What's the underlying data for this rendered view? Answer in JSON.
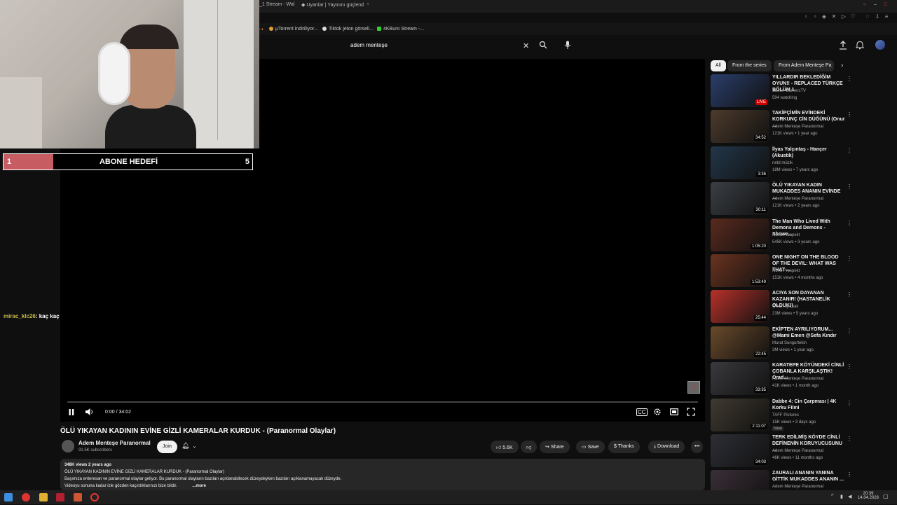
{
  "browser": {
    "tabs": [
      "_1 Stream - Wal",
      "Uyarılar | Yayınını güçlend"
    ],
    "bookmarks": [
      "μTorrent indiriliyor...",
      "Tiktok jeton görseli...",
      "4KBuro Stream -..."
    ]
  },
  "header": {
    "search_value": "adem menteşe"
  },
  "overlay": {
    "goal_label": "ABONE HEDEFİ",
    "goal_current": "1",
    "goal_target": "5",
    "goal_fraction": 0.2,
    "chat_user": "mirac_klc26",
    "chat_message": ": kaç kaç"
  },
  "player": {
    "time": "0:00 / 34:02"
  },
  "video": {
    "title": "ÖLÜ YIKAYAN KADININ EVİNE GİZLİ KAMERALAR KURDUK - (Paranormal Olaylar)",
    "channel": "Adem Menteşe Paranormal",
    "subscribers": "91.5K subscribers",
    "join_label": "Join",
    "likes": "5.6K",
    "share_label": "Share",
    "save_label": "Save",
    "thanks_label": "Thanks",
    "download_label": "Download"
  },
  "description": {
    "meta": "348K views  2 years ago",
    "line1": "ÖLÜ YIKAYAN KADININ EVİNE GİZLİ KAMERALAR KURDUK - (Paranormal Olaylar)",
    "line2": "Başımıza enteresan ve paranormal olaylar geliyor. Bu paranormal olayların bazıları açıklanabilecek düzeydeyken bazıları açıklanamayacak düzeyde.",
    "line3": "Videoyu sonuna kadar izle gözden kaçırdıklarınızı bize bildir.",
    "more": "...more"
  },
  "sidebar": {
    "chips": [
      "All",
      "From the series",
      "From Adem Menteşe Pa"
    ],
    "videos": [
      {
        "title": "YILLARDIR BEKLEDİĞİM OYUN!! - REPLACED TÜRKÇE BÖLÜM 1",
        "channel": "Easter GamersTV",
        "meta": "594 watching",
        "duration": "LIVE",
        "color": "#2a3e6b"
      },
      {
        "title": "TAKİPÇİMİN EVİNDEKİ KORKUNÇ CİN DÜĞÜNÜ (Onur ...",
        "channel": "Adem Menteşe Paranormal",
        "meta": "121K views • 1 year ago",
        "duration": "34:52",
        "color": "#4d3b2c"
      },
      {
        "title": "İlyas Yalçıntaş - Hançer (Akustik)",
        "channel": "netd müzik",
        "meta": "18M views • 7 years ago",
        "duration": "3:36",
        "color": "#22374a"
      },
      {
        "title": "ÖLÜ YIKAYAN KADIN MUKADDES ANANIN EVİNDE ...",
        "channel": "Adem Menteşe Paranormal",
        "meta": "121K views • 2 years ago",
        "duration": "30:11",
        "color": "#3b3f44"
      },
      {
        "title": "The Man Who Lived With Demons and Demons - Showe...",
        "channel": "Nova Prospekt",
        "meta": "545K views • 3 years ago",
        "duration": "1:05:20",
        "color": "#5a2a1e"
      },
      {
        "title": "ONE NIGHT ON THE BLOOD OF THE DEVIL: WHAT WAS THAT ...",
        "channel": "Nova Prospekt",
        "meta": "151K views • 4 months ago",
        "duration": "1:53:49",
        "color": "#6b3320"
      },
      {
        "title": "ACIYA SON DAYANAN KAZANIR! (HASTANELİK OLDUK!)",
        "channel": "Orkun Işıtmak",
        "meta": "23M views • 5 years ago",
        "duration": "25:44",
        "color": "#b8312a"
      },
      {
        "title": "EKİPTEN AYRILIYORUM... @Mami Emen @Sefa Kındır",
        "channel": "Murat Sungurtekin",
        "meta": "3M views • 1 year ago",
        "duration": "22:45",
        "color": "#6a4a2a"
      },
      {
        "title": "KARATEPE KÖYÜNDEKİ CİNLİ ÇOBANLA KARŞILAŞTIK! Orad...",
        "channel": "Adem Menteşe Paranormal",
        "meta": "41K views • 1 month ago",
        "duration": "33:35",
        "color": "#3a3a3e"
      },
      {
        "title": "Dabbe 4: Cin Çarpması | 4K Korku Filmi",
        "channel": "TAFF Pictures",
        "meta": "15K views • 3 days ago",
        "badge": "New",
        "duration": "2:11:07",
        "color": "#403a30"
      },
      {
        "title": "TERK EDİLMİŞ KÖYDE CİNLİ DEFİNENİN KORUYUCUSUNU ...",
        "channel": "Adem Menteşe Paranormal",
        "meta": "46K views • 11 months ago",
        "duration": "34:03",
        "color": "#2e2f36"
      },
      {
        "title": "ZAURALI ANANIN YANINA GİTTİK MUKADDES ANANIN ...",
        "channel": "Adem Menteşe Paranormal",
        "meta": "",
        "duration": "",
        "color": "#3a3038"
      }
    ]
  },
  "taskbar": {
    "time": "20:39",
    "date": "14.04.2026"
  }
}
